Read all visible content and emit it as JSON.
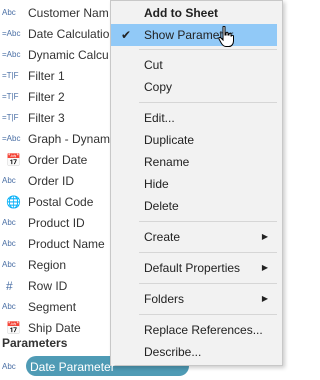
{
  "fields": [
    {
      "icon": "Abc",
      "label": "Customer Nam",
      "icon_name": "string-field-icon"
    },
    {
      "icon": "=Abc",
      "label": "Date Calculatio",
      "icon_name": "calc-string-icon"
    },
    {
      "icon": "=Abc",
      "label": "Dynamic Calcu",
      "icon_name": "calc-string-icon"
    },
    {
      "icon": "=T|F",
      "label": "Filter 1",
      "icon_name": "calc-boolean-icon"
    },
    {
      "icon": "=T|F",
      "label": "Filter 2",
      "icon_name": "calc-boolean-icon"
    },
    {
      "icon": "=T|F",
      "label": "Filter 3",
      "icon_name": "calc-boolean-icon"
    },
    {
      "icon": "=Abc",
      "label": "Graph - Dynam",
      "icon_name": "calc-string-icon"
    },
    {
      "icon": "📅",
      "label": "Order Date",
      "icon_name": "date-field-icon"
    },
    {
      "icon": "Abc",
      "label": "Order ID",
      "icon_name": "string-field-icon"
    },
    {
      "icon": "🌐",
      "label": "Postal Code",
      "icon_name": "geo-field-icon"
    },
    {
      "icon": "Abc",
      "label": "Product ID",
      "icon_name": "string-field-icon"
    },
    {
      "icon": "Abc",
      "label": "Product Name",
      "icon_name": "string-field-icon"
    },
    {
      "icon": "Abc",
      "label": "Region",
      "icon_name": "string-field-icon"
    },
    {
      "icon": "#",
      "label": "Row ID",
      "icon_name": "number-field-icon"
    },
    {
      "icon": "Abc",
      "label": "Segment",
      "icon_name": "string-field-icon"
    },
    {
      "icon": "📅",
      "label": "Ship Date",
      "icon_name": "date-field-icon"
    }
  ],
  "parameters": {
    "header": "Parameters",
    "items": [
      {
        "icon": "Abc",
        "label": "Date Parameter"
      }
    ]
  },
  "menu": {
    "add_to_sheet": "Add to Sheet",
    "show_parameter": "Show Parameter",
    "show_parameter_checked": "✔",
    "cut": "Cut",
    "copy": "Copy",
    "edit": "Edit...",
    "duplicate": "Duplicate",
    "rename": "Rename",
    "hide": "Hide",
    "delete": "Delete",
    "create": "Create",
    "default_properties": "Default Properties",
    "folders": "Folders",
    "replace_references": "Replace References...",
    "describe": "Describe...",
    "submenu_arrow": "▶"
  },
  "colors": {
    "highlight": "#91c9f7",
    "param_pill": "#4f9bb5",
    "icon_blue": "#4a6fa5"
  }
}
